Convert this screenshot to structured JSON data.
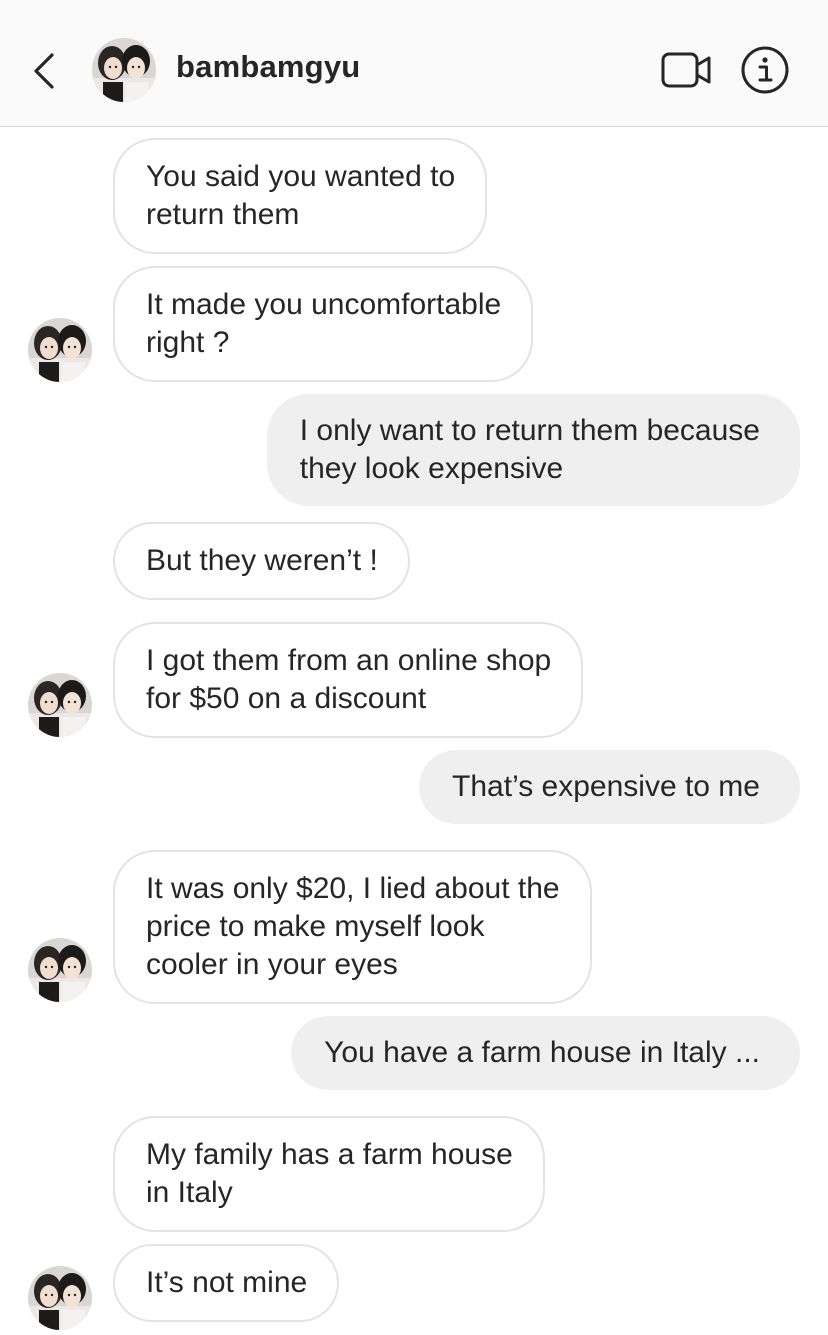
{
  "header": {
    "username": "bambamgyu",
    "back_icon": "chevron-left-icon",
    "video_icon": "video-camera-icon",
    "info_icon": "info-icon"
  },
  "messages": [
    {
      "from": "them",
      "text": "You said you wanted to\nreturn them"
    },
    {
      "from": "them",
      "text": "It made you uncomfortable\nright ?"
    },
    {
      "from": "me",
      "text": "I only want to return them because\nthey look expensive"
    },
    {
      "from": "them",
      "text": "But they weren’t !"
    },
    {
      "from": "them",
      "text": "I got them from an online shop\nfor $50 on a discount"
    },
    {
      "from": "me",
      "text": "That’s expensive to me"
    },
    {
      "from": "them",
      "text": "It was only $20, I lied about the\nprice to make myself look\ncooler in your eyes"
    },
    {
      "from": "me",
      "text": "You have a farm house in Italy ..."
    },
    {
      "from": "them",
      "text": "My family has a farm house\nin Italy"
    },
    {
      "from": "them",
      "text": "It’s not mine"
    }
  ],
  "colors": {
    "sent_bubble": "#efefef",
    "received_border": "#e3e3e3",
    "header_bg": "#fafafa",
    "text": "#262626"
  }
}
